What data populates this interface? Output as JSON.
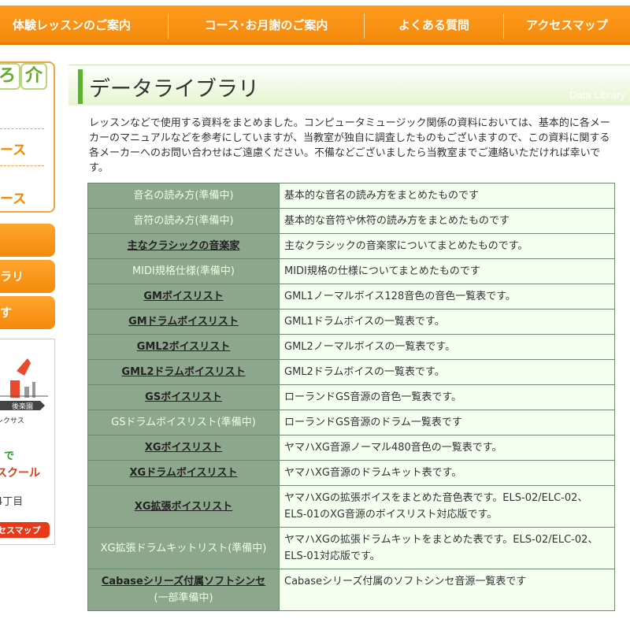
{
  "topnav": {
    "items": [
      "体験レッスンのご案内",
      "コース･お月謝のご案内",
      "よくある質問",
      "アクセスマップ"
    ]
  },
  "sidebar": {
    "tiles": [
      "ろ",
      "介"
    ],
    "items": [
      "ース",
      "ース"
    ],
    "buttons": [
      "",
      "ラリ",
      "す"
    ],
    "map": {
      "label_station": "後楽園",
      "label_place": "レクサス",
      "label_de": "で",
      "label_school": "スクール",
      "label_address": "4丁目",
      "button": "セスマップ"
    }
  },
  "header": {
    "title": "データライブラリ",
    "subtitle": "Data Library"
  },
  "intro": "レッスンなどで使用する資料をまとめました。コンピュータミュージック関係の資料においては、基本的に各メーカーのマニュアルなどを参考にしていますが、当教室が独自に調査したものもございますので、この資料に関する各メーカーへのお問い合わせはご遠慮ください。不備などございましたら当教室までご連絡いただければ幸いです。",
  "table": {
    "rows": [
      {
        "name": "音名の読み方(準備中)",
        "desc": "基本的な音名の読み方をまとめたものです",
        "link": false
      },
      {
        "name": "音符の読み方(準備中)",
        "desc": "基本的な音符や休符の読み方をまとめたものです",
        "link": false
      },
      {
        "name": "主なクラシックの音楽家",
        "desc": "主なクラシックの音楽家についてまとめたものです。",
        "link": true
      },
      {
        "name": "MIDI規格仕様(準備中)",
        "desc": "MIDI規格の仕様についてまとめたものです",
        "link": false
      },
      {
        "name": "GMボイスリスト",
        "desc": "GML1ノーマルボイス128音色の音色一覧表です。",
        "link": true
      },
      {
        "name": "GMドラムボイスリスト",
        "desc": "GML1ドラムボイスの一覧表です。",
        "link": true
      },
      {
        "name": "GML2ボイスリスト",
        "desc": "GML2ノーマルボイスの一覧表です。",
        "link": true
      },
      {
        "name": "GML2ドラムボイスリスト",
        "desc": "GML2ドラムボイスの一覧表です。",
        "link": true
      },
      {
        "name": "GSボイスリスト",
        "desc": "ローランドGS音源の音色一覧表です。",
        "link": true
      },
      {
        "name": "GSドラムボイスリスト(準備中)",
        "desc": "ローランドGS音源のドラム一覧表です",
        "link": false
      },
      {
        "name": "XGボイスリスト",
        "desc": "ヤマハXG音源ノーマル480音色の一覧表です。",
        "link": true
      },
      {
        "name": "XGドラムボイスリスト",
        "desc": "ヤマハXG音源のドラムキット表です。",
        "link": true
      },
      {
        "name": "XG拡張ボイスリスト",
        "desc": "ヤマハXGの拡張ボイスをまとめた音色表です。ELS-02/ELC-02、ELS-01のXG音源のボイスリスト対応版です。",
        "link": true
      },
      {
        "name": "XG拡張ドラムキットリスト(準備中)",
        "desc": "ヤマハXGの拡張ドラムキットをまとめた表です。ELS-02/ELC-02、ELS-01対応版です。",
        "link": false
      },
      {
        "name": "Cabaseシリーズ付属ソフトシンセ",
        "name2": "(一部準備中)",
        "desc": "Cabaseシリーズ付属のソフトシンセ音源一覧表です",
        "link": true
      }
    ]
  },
  "colors": {
    "nav_orange": "#f38a0c",
    "green_accent": "#5cb12d",
    "table_head": "#8da78d",
    "table_cell": "#f4fff0"
  }
}
